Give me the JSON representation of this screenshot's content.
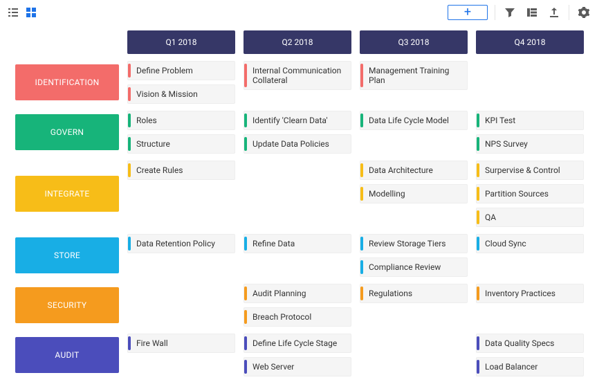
{
  "toolbar": {
    "add_label": "+"
  },
  "columns": [
    "Q1 2018",
    "Q2 2018",
    "Q3 2018",
    "Q4 2018"
  ],
  "rows": [
    {
      "label": "IDENTIFICATION",
      "color": "#f36c6a",
      "cells": [
        [
          "Define Problem",
          "Vision & Mission"
        ],
        [
          "Internal Communication Collateral"
        ],
        [
          "Management Training Plan"
        ],
        []
      ]
    },
    {
      "label": "GOVERN",
      "color": "#17b47a",
      "cells": [
        [
          "Roles",
          "Structure"
        ],
        [
          "Identify 'Clearn Data'",
          "Update Data Policies"
        ],
        [
          "Data Life Cycle Model"
        ],
        [
          "KPI Test",
          "NPS Survey"
        ]
      ]
    },
    {
      "label": "INTEGRATE",
      "color": "#f7bd18",
      "cells": [
        [
          "Create Rules"
        ],
        [],
        [
          "Data Architecture",
          "Modelling"
        ],
        [
          "Surpervise & Control",
          "Partition Sources",
          "QA"
        ]
      ]
    },
    {
      "label": "STORE",
      "color": "#18aee5",
      "cells": [
        [
          "Data Retention Policy"
        ],
        [
          "Refine Data"
        ],
        [
          "Review Storage Tiers",
          "Compliance Review"
        ],
        [
          "Cloud Sync"
        ]
      ]
    },
    {
      "label": "SECURITY",
      "color": "#f59b1e",
      "cells": [
        [],
        [
          "Audit Planning",
          "Breach Protocol"
        ],
        [
          "Regulations"
        ],
        [
          "Inventory Practices"
        ]
      ]
    },
    {
      "label": "AUDIT",
      "color": "#4b4dbb",
      "cells": [
        [
          "Fire Wall"
        ],
        [
          "Define Life Cycle Stage",
          "Web Server"
        ],
        [],
        [
          "Data Quality Specs",
          "Load Balancer"
        ]
      ]
    }
  ]
}
